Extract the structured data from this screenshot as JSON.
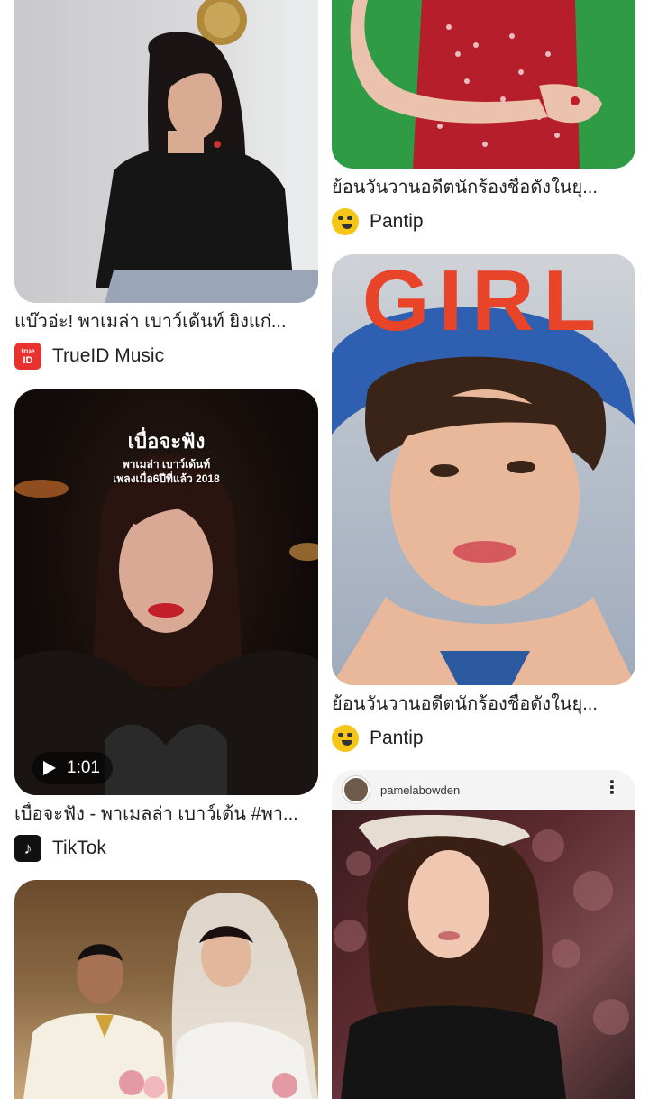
{
  "left_column": [
    {
      "title": "แบ๊วอ่ะ! พาเมล่า เบาว์เด้นท์ ยิงแก่...",
      "source": "TrueID Music",
      "source_icon": "trueid-icon",
      "icon_text_top": "true",
      "icon_text_bottom": "ID"
    },
    {
      "title": "เบื่อจะฟัง - พาเมลล่า เบาว์เด้น #พา...",
      "source": "TikTok",
      "source_icon": "tiktok-icon",
      "video_duration": "1:01",
      "overlay_title": "เบื่อจะฟัง",
      "overlay_line1": "พาเมล่า เบาว์เด้นท์",
      "overlay_line2": "เพลงเมื่อ6ปีที่แล้ว 2018"
    },
    {
      "title": "",
      "source": ""
    }
  ],
  "right_column": [
    {
      "title": "ย้อนวันวานอดีตนักร้องชื่อดังในยุ...",
      "source": "Pantip",
      "source_icon": "pantip-icon"
    },
    {
      "title": "ย้อนวันวานอดีตนักร้องชื่อดังในยุ...",
      "source": "Pantip",
      "source_icon": "pantip-icon",
      "cover_text": "GIRL"
    },
    {
      "ig_username": "pamelabowden",
      "ig_more": "⋮"
    }
  ],
  "colors": {
    "trueid": "#e8322f",
    "tiktok": "#111111",
    "pantip": "#f5c518",
    "girl_logo": "#e8442a"
  }
}
